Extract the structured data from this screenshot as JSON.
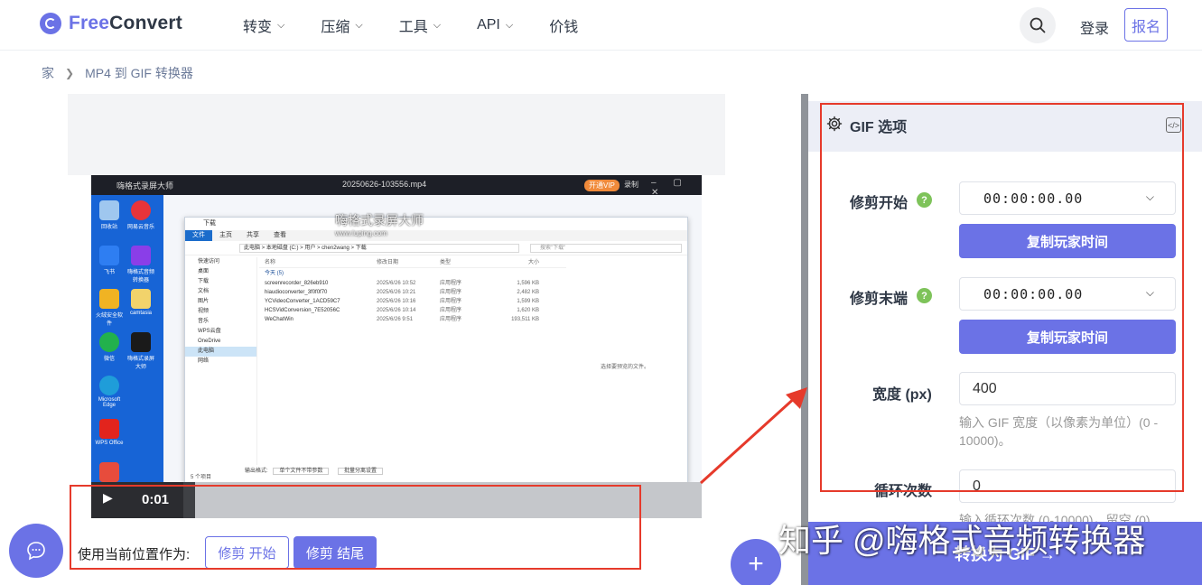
{
  "header": {
    "logo_free": "Free",
    "logo_convert": "Convert",
    "nav": [
      {
        "label": "转变",
        "has_dropdown": true
      },
      {
        "label": "压缩",
        "has_dropdown": true
      },
      {
        "label": "工具",
        "has_dropdown": true
      },
      {
        "label": "API",
        "has_dropdown": true
      },
      {
        "label": "价钱",
        "has_dropdown": false
      }
    ],
    "search_icon": "search-icon",
    "login": "登录",
    "signup": "报名"
  },
  "breadcrumb": {
    "home": "家",
    "current": "MP4 到 GIF 转换器"
  },
  "video": {
    "recorder_title": "嗨格式录屏大师",
    "file_name": "20250626-103556.mp4",
    "vip_badge": "开通VIP",
    "rec_label": "录制",
    "watermark_name": "嗨格式录屏大师",
    "watermark_url": "www.luping.com",
    "explorer": {
      "title": "下载",
      "ribbon": [
        "文件",
        "主页",
        "共享",
        "查看"
      ],
      "path": "此电脑 > 本地磁盘 (C:) > 用户 > chen2wang > 下载",
      "search_placeholder": "搜索\"下载\"",
      "sidebar": [
        "快速访问",
        "桌面",
        "下载",
        "文档",
        "图片",
        "视频",
        "音乐",
        "WPS云盘",
        "OneDrive",
        "此电脑",
        "网络"
      ],
      "columns": [
        "名称",
        "修改日期",
        "类型",
        "大小"
      ],
      "group": "今天 (5)",
      "files": [
        {
          "name": "screenrecorder_826eb910",
          "date": "2025/6/26 10:52",
          "type": "应用程序",
          "size": "1,596 KB"
        },
        {
          "name": "hiaudioconverter_3f0f0f70",
          "date": "2025/6/26 10:21",
          "type": "应用程序",
          "size": "2,482 KB"
        },
        {
          "name": "YCVideoConverter_1ACD59C7",
          "date": "2025/6/26 10:16",
          "type": "应用程序",
          "size": "1,599 KB"
        },
        {
          "name": "HCSVidConversion_7E52056C",
          "date": "2025/6/26 10:14",
          "type": "应用程序",
          "size": "1,620 KB"
        },
        {
          "name": "WeChatWin",
          "date": "2025/6/26 9:51",
          "type": "应用程序",
          "size": "193,511 KB"
        }
      ],
      "preview_text": "选择要预览的文件。",
      "status": "5 个项目",
      "output_format_label": "输出格式:",
      "output_format_value": "单个文件不带参数",
      "batch_label": "批量分离设置"
    },
    "desktop_icons": [
      "回收站",
      "网易云音乐",
      "飞书",
      "嗨格式音频转换器",
      "火绒安全软件",
      "camtasia",
      "微信",
      "嗨格式录屏大师",
      "Microsoft Edge",
      "WPS Office",
      ""
    ],
    "time": "0:01",
    "progress": 0.17
  },
  "trim_controls": {
    "use_position_label": "使用当前位置作为:",
    "trim_start": "修剪 开始",
    "trim_end": "修剪 结尾"
  },
  "options_panel": {
    "title": "GIF 选项",
    "trim_start_label": "修剪开始",
    "trim_start_value": "00:00:00.00",
    "trim_end_label": "修剪末端",
    "trim_end_value": "00:00:00.00",
    "copy_player_time": "复制玩家时间",
    "width_label": "宽度 (px)",
    "width_value": "400",
    "width_hint": "输入 GIF 宽度（以像素为单位）(0 - 10000)。",
    "loop_label": "循环次数",
    "loop_value": "0",
    "loop_hint": "输入循环次数 (0-10000)，留空 (0)",
    "convert_button": "转换为 GIF →"
  },
  "watermark": "知乎 @嗨格式音频转换器",
  "colors": {
    "brand": "#6b72e6",
    "help": "#7ec35a",
    "annotation_red": "#e63a2b"
  }
}
